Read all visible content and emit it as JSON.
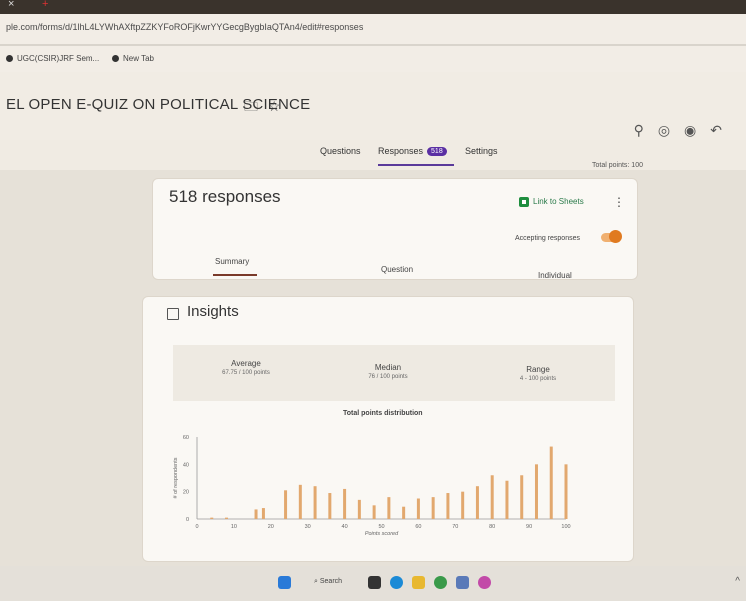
{
  "browser": {
    "url": "ple.com/forms/d/1lhL4LYWhAXftpZZKYFoROFjKwrYYGecgBygbIaQTAn4/edit#responses",
    "bookmark1": "UGC(CSIR)JRF Sem...",
    "bookmark2": "New Tab"
  },
  "form": {
    "title": "EL OPEN E-QUIZ ON POLITICAL SCIENCE",
    "tabs": [
      "Questions",
      "Responses",
      "Settings"
    ],
    "responses_badge": "518",
    "total_points": "Total points: 100"
  },
  "summary_card": {
    "responses_label": "518 responses",
    "link_to_sheets": "Link to Sheets",
    "accepting": "Accepting responses",
    "subtabs": [
      "Summary",
      "Question",
      "Individual"
    ]
  },
  "insights": {
    "title": "Insights",
    "average_label": "Average",
    "average_value": "67.75 / 100 points",
    "median_label": "Median",
    "median_value": "76 / 100 points",
    "range_label": "Range",
    "range_value": "4 - 100 points"
  },
  "chart_data": {
    "type": "bar",
    "title": "Total points distribution",
    "xlabel": "Points scored",
    "ylabel": "# of respondents",
    "xlim": [
      0,
      100
    ],
    "ylim": [
      0,
      60
    ],
    "x_ticks": [
      0,
      10,
      20,
      30,
      40,
      50,
      60,
      70,
      80,
      90,
      100
    ],
    "y_ticks": [
      0,
      20,
      40,
      60
    ],
    "x": [
      4,
      8,
      16,
      18,
      24,
      28,
      32,
      36,
      40,
      44,
      48,
      52,
      56,
      60,
      64,
      68,
      72,
      76,
      80,
      84,
      88,
      92,
      96,
      100
    ],
    "values": [
      1,
      1,
      7,
      8,
      21,
      25,
      24,
      19,
      22,
      14,
      10,
      16,
      9,
      15,
      16,
      19,
      20,
      24,
      32,
      28,
      32,
      40,
      53,
      40
    ],
    "bar_color": "#e2a86e"
  },
  "taskbar": {
    "search_label": "Search"
  }
}
